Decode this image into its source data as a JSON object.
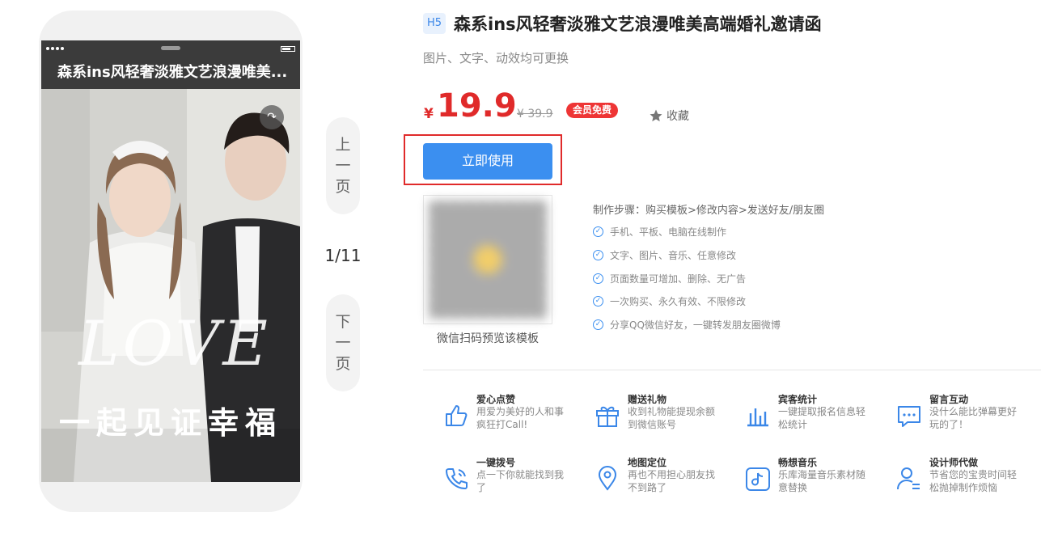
{
  "preview": {
    "title": "森系ins风轻奢淡雅文艺浪漫唯美...",
    "love_script": "LOVE",
    "slogan": "一起见证幸福"
  },
  "pager": {
    "prev": [
      "上",
      "一",
      "页"
    ],
    "next": [
      "下",
      "一",
      "页"
    ],
    "counter": "1/11"
  },
  "product": {
    "badge": "H5",
    "title": "森系ins风轻奢淡雅文艺浪漫唯美高端婚礼邀请函",
    "subtitle": "图片、文字、动效均可更换",
    "currency": "¥",
    "price": "19.9",
    "original_price": "¥ 39.9",
    "vip_badge": "会员免费",
    "favorite_label": "收藏",
    "use_button": "立即使用",
    "qr_caption": "微信扫码预览该模板"
  },
  "steps": {
    "title": "制作步骤：购买模板>修改内容>发送好友/朋友圈",
    "items": [
      "手机、平板、电脑在线制作",
      "文字、图片、音乐、任意修改",
      "页面数量可增加、删除、无广告",
      "一次购买、永久有效、不限修改",
      "分享QQ微信好友，一键转发朋友圈微博"
    ]
  },
  "features": [
    {
      "name": "爱心点赞",
      "desc": "用爱为美好的人和事疯狂打Call!",
      "icon": "thumbs-up-icon"
    },
    {
      "name": "赠送礼物",
      "desc": "收到礼物能提现余额到微信账号",
      "icon": "gift-icon"
    },
    {
      "name": "宾客统计",
      "desc": "一键提取报名信息轻松统计",
      "icon": "bar-chart-icon"
    },
    {
      "name": "留言互动",
      "desc": "没什么能比弹幕更好玩的了！",
      "icon": "message-icon"
    },
    {
      "name": "一键拨号",
      "desc": "点一下你就能找到我了",
      "icon": "phone-icon"
    },
    {
      "name": "地图定位",
      "desc": "再也不用担心朋友找不到路了",
      "icon": "map-pin-icon"
    },
    {
      "name": "畅想音乐",
      "desc": "乐库海量音乐素材随意替换",
      "icon": "music-icon"
    },
    {
      "name": "设计师代做",
      "desc": "节省您的宝贵时间轻松抛掉制作烦恼",
      "icon": "designer-icon"
    }
  ],
  "colors": {
    "accent": "#3b8ff0",
    "price": "#e02a2a",
    "vip": "#ee3535"
  }
}
